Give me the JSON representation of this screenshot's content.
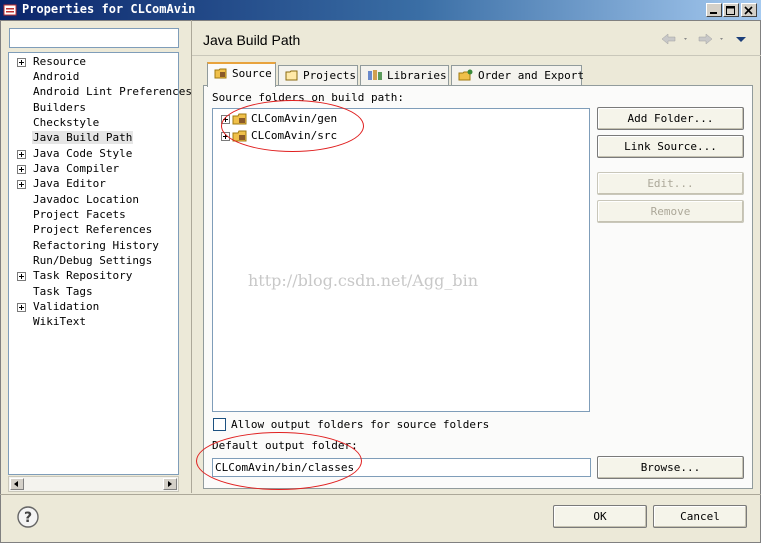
{
  "window": {
    "title": "Properties for CLComAvin"
  },
  "filter": {
    "value": ""
  },
  "nav": {
    "items": [
      {
        "label": "Resource",
        "expandable": true
      },
      {
        "label": "Android",
        "expandable": false
      },
      {
        "label": "Android Lint Preferences",
        "expandable": false
      },
      {
        "label": "Builders",
        "expandable": false
      },
      {
        "label": "Checkstyle",
        "expandable": false
      },
      {
        "label": "Java Build Path",
        "expandable": false,
        "selected": true
      },
      {
        "label": "Java Code Style",
        "expandable": true
      },
      {
        "label": "Java Compiler",
        "expandable": true
      },
      {
        "label": "Java Editor",
        "expandable": true
      },
      {
        "label": "Javadoc Location",
        "expandable": false
      },
      {
        "label": "Project Facets",
        "expandable": false
      },
      {
        "label": "Project References",
        "expandable": false
      },
      {
        "label": "Refactoring History",
        "expandable": false
      },
      {
        "label": "Run/Debug Settings",
        "expandable": false
      },
      {
        "label": "Task Repository",
        "expandable": true
      },
      {
        "label": "Task Tags",
        "expandable": false
      },
      {
        "label": "Validation",
        "expandable": true
      },
      {
        "label": "WikiText",
        "expandable": false
      }
    ]
  },
  "page": {
    "title": "Java Build Path"
  },
  "tabs": [
    {
      "label": "Source",
      "icon": "source-folder-icon",
      "active": true
    },
    {
      "label": "Projects",
      "icon": "projects-icon"
    },
    {
      "label": "Libraries",
      "icon": "libraries-icon"
    },
    {
      "label": "Order and Export",
      "icon": "order-export-icon"
    }
  ],
  "source": {
    "label": "Source folders on build path:",
    "folders": [
      {
        "label": "CLComAvin/gen"
      },
      {
        "label": "CLComAvin/src"
      }
    ]
  },
  "buttons": {
    "add_folder": "Add Folder...",
    "link_source": "Link Source...",
    "edit": "Edit...",
    "remove": "Remove",
    "browse": "Browse...",
    "ok": "OK",
    "cancel": "Cancel"
  },
  "watermark": "http://blog.csdn.net/Agg_bin",
  "allow_output": {
    "label": "Allow output folders for source folders",
    "checked": false
  },
  "output": {
    "label": "Default output folder:",
    "value": "CLComAvin/bin/classes"
  },
  "colors": {
    "annotation": "#e02020",
    "tab_highlight": "#e8a33d",
    "title_bar": "#0a246a"
  }
}
